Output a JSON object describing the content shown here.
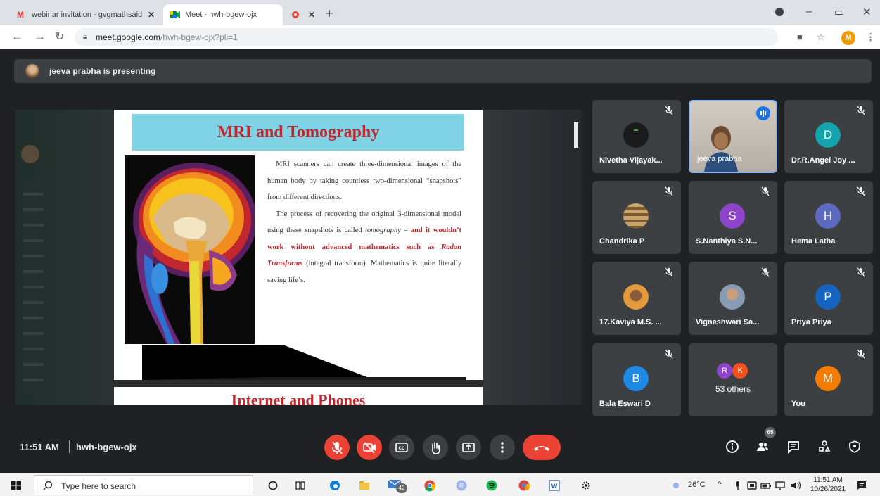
{
  "browser": {
    "tabs": [
      {
        "title": "webinar invitation - gvgmathsaid",
        "favicon": "gmail-icon"
      },
      {
        "title": "Meet - hwh-bgew-ojx",
        "favicon": "meet-icon"
      },
      {
        "title": "",
        "favicon": "recording-icon"
      }
    ],
    "url_host": "meet.google.com",
    "url_path": "/hwh-bgew-ojx?pli=1",
    "profile_initial": "M"
  },
  "meet": {
    "presenting_text": "jeeva prabha is presenting",
    "time": "11:51 AM",
    "meeting_code": "hwh-bgew-ojx",
    "participant_count": "65"
  },
  "slide": {
    "title": "MRI and Tomography",
    "para1": "MRI scanners can create three-dimensional images of the human body by taking countless two-dimensional “snapshots” from different directions.",
    "para2_a": "The process of recovering the original 3-dimensional model using these snapshots is called ",
    "para2_b": "tomography",
    "para2_c": " – ",
    "para2_d": "and it wouldn’t work without advanced mathematics such as ",
    "para2_e": "Radon Transforms",
    "para2_f": " (integral transform). Mathematics is quite literally saving life’s.",
    "next_title": "Internet and Phones"
  },
  "participants": [
    {
      "name": "Nivetha Vijayak...",
      "avatar_type": "photo",
      "color": "#1b1b1b"
    },
    {
      "name": "jeeva prabha",
      "avatar_type": "video",
      "color": "#c9c2b8"
    },
    {
      "name": "Dr.R.Angel Joy ...",
      "avatar_type": "letter",
      "letter": "D",
      "color": "#12a4af"
    },
    {
      "name": "Chandrika P",
      "avatar_type": "photo",
      "color": "#9b7a4a"
    },
    {
      "name": "S.Nanthiya S.N...",
      "avatar_type": "letter",
      "letter": "S",
      "color": "#8e44c8"
    },
    {
      "name": "Hema Latha",
      "avatar_type": "letter",
      "letter": "H",
      "color": "#5c6bc0"
    },
    {
      "name": "17.Kaviya M.S. ...",
      "avatar_type": "photo",
      "color": "#e39a3a"
    },
    {
      "name": "Vigneshwari Sa...",
      "avatar_type": "photo",
      "color": "#8a9bb5"
    },
    {
      "name": "Priya Priya",
      "avatar_type": "letter",
      "letter": "P",
      "color": "#1565c0"
    },
    {
      "name": "Bala Eswari D",
      "avatar_type": "letter",
      "letter": "B",
      "color": "#1e88e5"
    },
    {
      "name": "53 others",
      "avatar_type": "group",
      "letters": [
        "R",
        "K"
      ],
      "colors": [
        "#8e44c8",
        "#f4511e"
      ]
    },
    {
      "name": "You",
      "avatar_type": "letter",
      "letter": "M",
      "color": "#f57c00"
    }
  ],
  "taskbar": {
    "search_placeholder": "Type here to search",
    "mail_badge": "42",
    "temperature": "26°C",
    "time": "11:51 AM",
    "date": "10/26/2021"
  },
  "colors": {
    "meet_bg": "#202124",
    "tile_bg": "#3c4043",
    "danger": "#ea4335",
    "accent": "#8ab4f8",
    "slide_title_bg": "#7fd3e4",
    "slide_title_fg": "#c0272d"
  }
}
